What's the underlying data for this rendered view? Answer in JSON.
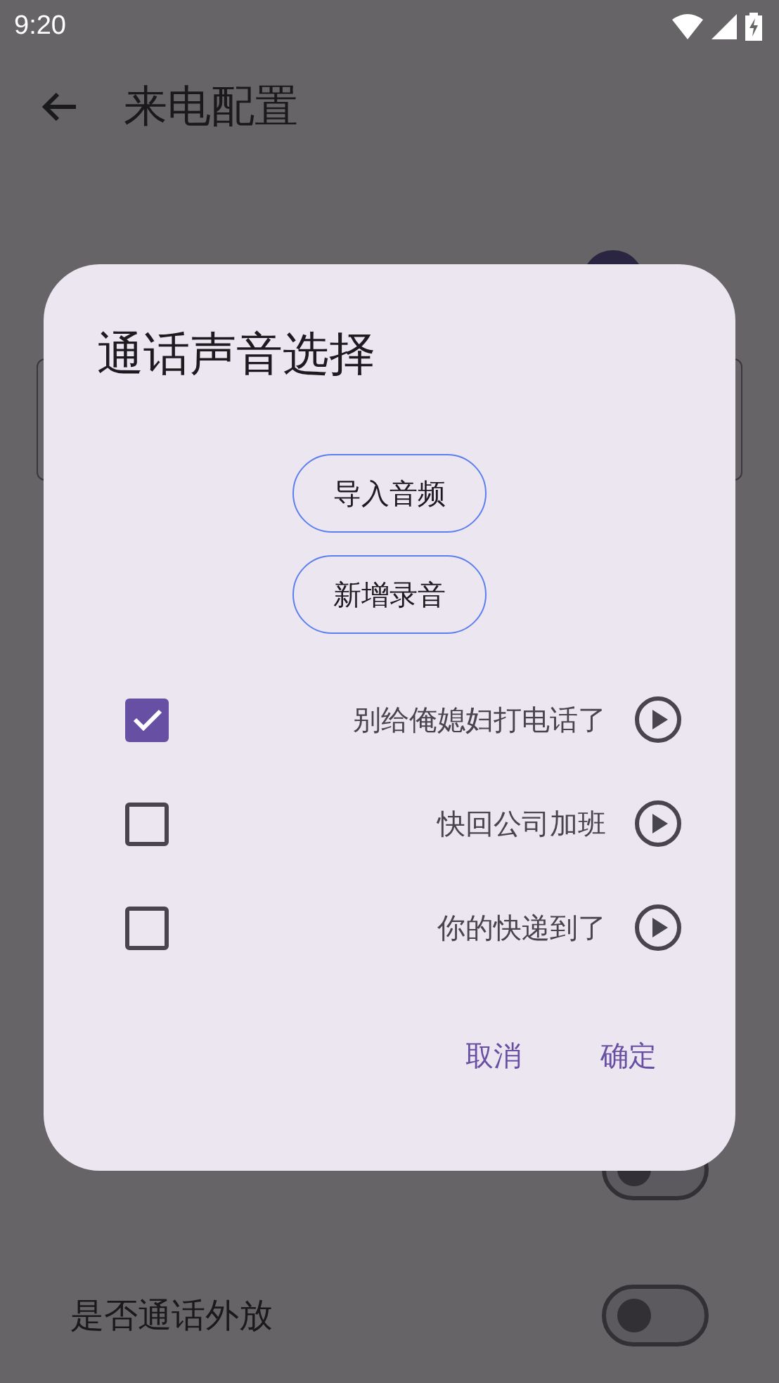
{
  "status_bar": {
    "time": "9:20"
  },
  "app_bar": {
    "title": "来电配置"
  },
  "settings": [
    {
      "kind": "switch",
      "on": false
    },
    {
      "kind": "switch",
      "label": "是否通话外放",
      "on": false
    }
  ],
  "dialog": {
    "title": "通话声音选择",
    "actions": [
      "导入音频",
      "新增录音"
    ],
    "sounds": [
      {
        "name": "别给俺媳妇打电话了",
        "checked": true
      },
      {
        "name": "快回公司加班",
        "checked": false
      },
      {
        "name": "你的快递到了",
        "checked": false
      }
    ],
    "buttons": [
      "取消",
      "确定"
    ]
  }
}
